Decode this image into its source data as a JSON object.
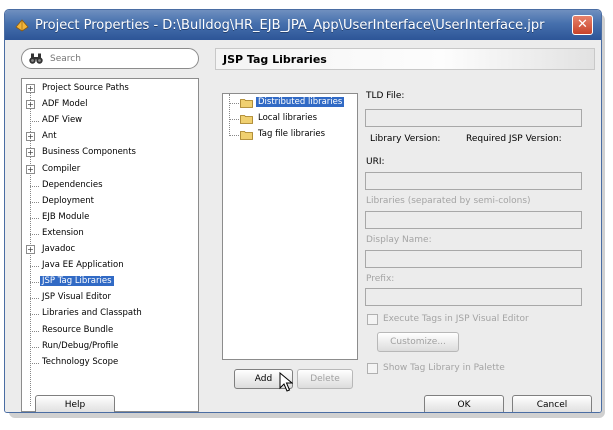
{
  "window": {
    "title": "Project Properties - D:\\Bulldog\\HR_EJB_JPA_App\\UserInterface\\UserInterface.jpr",
    "close_glyph": "✕"
  },
  "search": {
    "placeholder": "Search"
  },
  "nav": {
    "items": [
      {
        "label": "Project Source Paths",
        "expandable": true
      },
      {
        "label": "ADF Model",
        "expandable": true
      },
      {
        "label": "ADF View",
        "expandable": false
      },
      {
        "label": "Ant",
        "expandable": true
      },
      {
        "label": "Business Components",
        "expandable": true
      },
      {
        "label": "Compiler",
        "expandable": true
      },
      {
        "label": "Dependencies",
        "expandable": false
      },
      {
        "label": "Deployment",
        "expandable": false
      },
      {
        "label": "EJB Module",
        "expandable": false
      },
      {
        "label": "Extension",
        "expandable": false
      },
      {
        "label": "Javadoc",
        "expandable": true
      },
      {
        "label": "Java EE Application",
        "expandable": false
      },
      {
        "label": "JSP Tag Libraries",
        "expandable": false,
        "selected": true
      },
      {
        "label": "JSP Visual Editor",
        "expandable": false
      },
      {
        "label": "Libraries and Classpath",
        "expandable": false
      },
      {
        "label": "Resource Bundle",
        "expandable": false
      },
      {
        "label": "Run/Debug/Profile",
        "expandable": false
      },
      {
        "label": "Technology Scope",
        "expandable": false
      }
    ]
  },
  "panel": {
    "title": "JSP Tag Libraries",
    "libraries": [
      {
        "label": "Distributed libraries",
        "selected": true
      },
      {
        "label": "Local libraries"
      },
      {
        "label": "Tag file libraries"
      }
    ],
    "add_button": "Add",
    "delete_button": "Delete",
    "tld_file_label": "TLD File:",
    "library_version_label": "Library Version:",
    "required_jsp_version_label": "Required JSP Version:",
    "uri_label": "URI:",
    "libraries_label": "Libraries (separated by semi-colons)",
    "display_name_label": "Display Name:",
    "prefix_label": "Prefix:",
    "execute_tags_label": "Execute Tags in JSP Visual Editor",
    "customize_button": "Customize...",
    "show_in_palette_label": "Show Tag Library in Palette"
  },
  "footer": {
    "help_button": "Help",
    "ok_button": "OK",
    "cancel_button": "Cancel"
  },
  "colors": {
    "titlebar": "#4670ad",
    "selection": "#316ac5",
    "close": "#c7432a"
  }
}
